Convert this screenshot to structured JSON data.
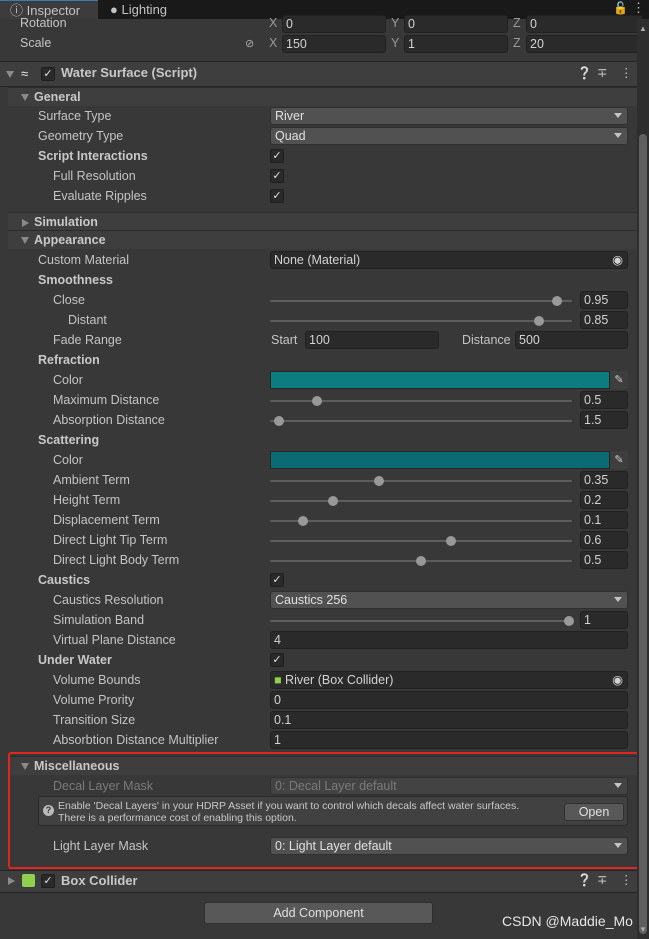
{
  "tabs": [
    {
      "label": "Inspector",
      "icon": "info-icon"
    },
    {
      "label": "Lighting",
      "icon": "lightbulb-icon"
    }
  ],
  "transform": {
    "rotation": {
      "label": "Rotation",
      "x": "0",
      "y": "0",
      "z": "0"
    },
    "scale": {
      "label": "Scale",
      "x": "150",
      "y": "1",
      "z": "20"
    }
  },
  "axes": [
    "X",
    "Y",
    "Z"
  ],
  "component": {
    "title": "Water Surface (Script)",
    "enabled": true
  },
  "rows": [
    {
      "type": "group",
      "label": "General",
      "open": true
    },
    {
      "type": "drop",
      "label": "Surface Type",
      "value": "River",
      "lvl": 1
    },
    {
      "type": "drop",
      "label": "Geometry Type",
      "value": "Quad",
      "lvl": 1
    },
    {
      "type": "check",
      "label": "Script Interactions",
      "lvl": 1,
      "bold": true,
      "checked": true
    },
    {
      "type": "check",
      "label": "Full Resolution",
      "lvl": 2,
      "checked": true
    },
    {
      "type": "check",
      "label": "Evaluate Ripples",
      "lvl": 2,
      "checked": true
    },
    {
      "type": "group",
      "label": "Simulation",
      "open": false
    },
    {
      "type": "group",
      "label": "Appearance",
      "open": true
    },
    {
      "type": "object",
      "label": "Custom Material",
      "value": "None (Material)",
      "lvl": 1
    },
    {
      "type": "heading",
      "label": "Smoothness",
      "lvl": 1
    },
    {
      "type": "slider",
      "label": "Close",
      "value": "0.95",
      "level": 0.95,
      "lvl": 2
    },
    {
      "type": "slider",
      "label": "Distant",
      "value": "0.85",
      "level": 0.89,
      "lvl": 3
    },
    {
      "type": "range",
      "label": "Fade Range",
      "start_label": "Start",
      "start": "100",
      "dist_label": "Distance",
      "distance": "500",
      "lvl": 2
    },
    {
      "type": "heading",
      "label": "Refraction",
      "lvl": 1
    },
    {
      "type": "color",
      "label": "Color",
      "color": "#0d7c7f",
      "lvl": 2
    },
    {
      "type": "slider",
      "label": "Maximum Distance",
      "value": "0.5",
      "level": 0.155,
      "lvl": 2
    },
    {
      "type": "slider",
      "label": "Absorption Distance",
      "value": "1.5",
      "level": 0.03,
      "lvl": 2
    },
    {
      "type": "heading",
      "label": "Scattering",
      "lvl": 1
    },
    {
      "type": "color",
      "label": "Color",
      "color": "#0a6b73",
      "lvl": 2
    },
    {
      "type": "slider",
      "label": "Ambient Term",
      "value": "0.35",
      "level": 0.36,
      "lvl": 2
    },
    {
      "type": "slider",
      "label": "Height Term",
      "value": "0.2",
      "level": 0.21,
      "lvl": 2
    },
    {
      "type": "slider",
      "label": "Displacement Term",
      "value": "0.1",
      "level": 0.11,
      "lvl": 2
    },
    {
      "type": "slider",
      "label": "Direct Light Tip Term",
      "value": "0.6",
      "level": 0.6,
      "lvl": 2
    },
    {
      "type": "slider",
      "label": "Direct Light Body Term",
      "value": "0.5",
      "level": 0.5,
      "lvl": 2
    },
    {
      "type": "check",
      "label": "Caustics",
      "lvl": 1,
      "bold": true,
      "checked": true
    },
    {
      "type": "drop",
      "label": "Caustics Resolution",
      "value": "Caustics 256",
      "lvl": 2
    },
    {
      "type": "slider",
      "label": "Simulation Band",
      "value": "1",
      "level": 0.99,
      "lvl": 2
    },
    {
      "type": "text",
      "label": "Virtual Plane Distance",
      "value": "4",
      "lvl": 2
    },
    {
      "type": "check",
      "label": "Under Water",
      "lvl": 1,
      "bold": true,
      "checked": true
    },
    {
      "type": "object",
      "label": "Volume Bounds",
      "value": "River (Box Collider)",
      "icon": true,
      "lvl": 2
    },
    {
      "type": "text",
      "label": "Volume Prority",
      "value": "0",
      "lvl": 2
    },
    {
      "type": "text",
      "label": "Transition Size",
      "value": "0.1",
      "lvl": 2
    },
    {
      "type": "text",
      "label": "Absorbtion Distance Multiplier",
      "value": "1",
      "lvl": 2
    },
    {
      "type": "group",
      "label": "Miscellaneous",
      "open": true
    },
    {
      "type": "drop",
      "label": "Decal Layer Mask",
      "value": "0: Decal Layer default",
      "lvl": 2,
      "disabled": true
    },
    {
      "type": "help",
      "text1": "Enable 'Decal Layers' in your HDRP Asset if you want to control which decals affect water surfaces.",
      "text2": "There is a performance cost of enabling this option.",
      "button": "Open"
    },
    {
      "type": "drop",
      "label": "Light Layer Mask",
      "value": "0: Light Layer default",
      "lvl": 2
    }
  ],
  "box_collider": {
    "title": "Box Collider",
    "enabled": true
  },
  "add_component": "Add Component",
  "highlight_color": "#e0261f",
  "watermark": "CSDN @Maddie_Mo"
}
